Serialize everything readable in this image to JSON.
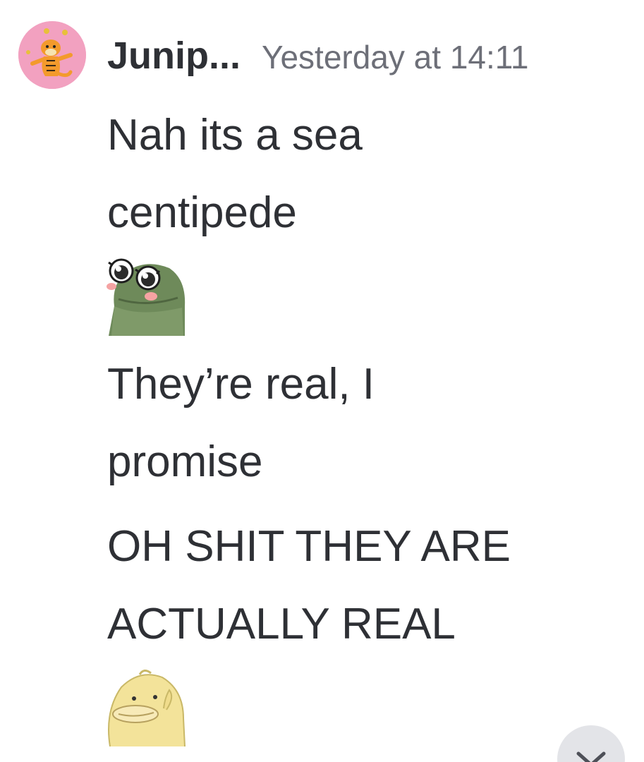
{
  "message": {
    "author": "Junip...",
    "timestamp": "Yesterday at 14:11",
    "lines": [
      "Nah its a sea",
      "centipede",
      "They’re real, I",
      "promise",
      "OH SHIT THEY ARE",
      "ACTUALLY REAL"
    ],
    "emojis": [
      "frog-emoji",
      "duck-emoji"
    ]
  },
  "avatar": {
    "icon": "tiger-avatar-icon",
    "background": "#f2a1c0"
  },
  "controls": {
    "scroll_icon": "chevron-down-icon"
  },
  "colors": {
    "text": "#2e3035",
    "timestamp": "#6d6f78",
    "button_bg": "#e3e4e8"
  }
}
